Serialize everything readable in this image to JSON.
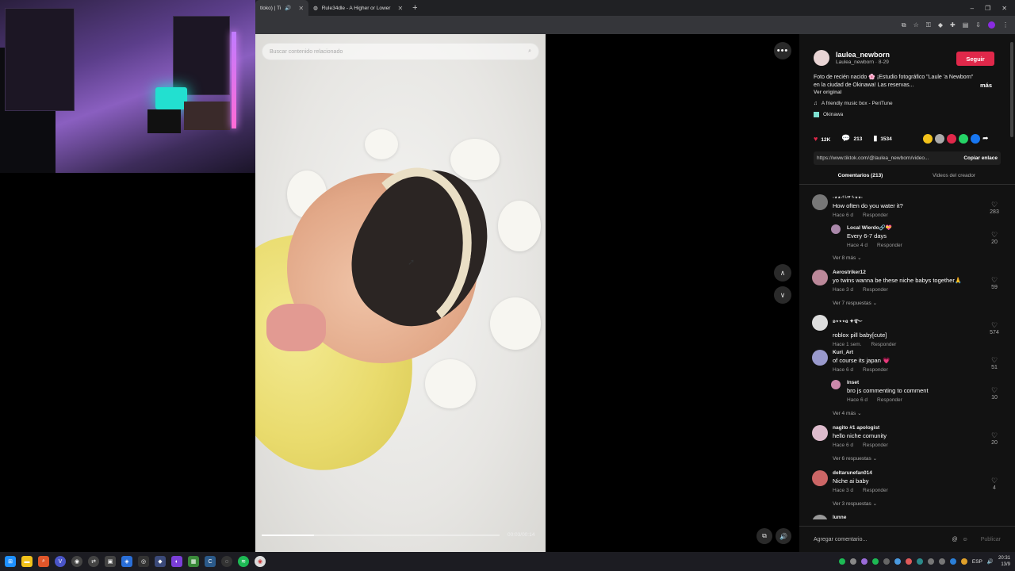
{
  "browser": {
    "tabs": [
      {
        "label": "tloko) | Ti",
        "active": true
      },
      {
        "label": "Rule34dle - A Higher or Lower",
        "active": false
      }
    ],
    "new_tab": "+",
    "window_controls": [
      "–",
      "❐",
      "✕"
    ]
  },
  "video": {
    "search_placeholder": "Buscar contenido relacionado",
    "time": "00:03/00:14",
    "progress": 0.22
  },
  "author": {
    "username": "laulea_newborn",
    "handle_date": "Laulea_newborn · 8-29",
    "follow_label": "Seguir"
  },
  "description": {
    "text": "Foto de recién nacido 🌸 ¡Estudio fotográfico \"Laule 'a Newborn\" en la ciudad de Okinawa! Las reservas...",
    "more": "más",
    "see_original": "Ver original",
    "music": "A friendly music box - PeriTune",
    "location": "Okinawa"
  },
  "stats": {
    "likes": "12K",
    "comments": "213",
    "saves": "1534"
  },
  "link": {
    "url": "https://www.tiktok.com/@laulea_newborn/video...",
    "copy_label": "Copiar enlace"
  },
  "panel_tabs": {
    "comments": "Comentarios (213)",
    "creator_videos": "Videos del creador"
  },
  "comments": [
    {
      "user": "·⋆⋆·ᵗ ᴸᵒʳ ᵗ·⋆⋆·",
      "text": "How often do you water it?",
      "time": "Hace 6 d",
      "reply": "Responder",
      "likes": "283",
      "color": "#777"
    },
    {
      "user": "Local Wierdo🔗💝",
      "text": "Every 6-7 days",
      "time": "Hace 4 d",
      "reply": "Responder",
      "likes": "20",
      "color": "#a8a"
    },
    {
      "user": "Aerostriker12",
      "text": "yo twins wanna be these niche babys together🙏",
      "time": "Hace 3 d",
      "reply": "Responder",
      "likes": "59",
      "color": "#b89"
    },
    {
      "user": "ʚ⋆⋆⋆ɞ ✦࿐",
      "text": "roblox pill baby[cute]",
      "time": "Hace 1 sem.",
      "reply": "Responder",
      "likes": "574",
      "color": "#ddd"
    },
    {
      "user": "Kuri_Art",
      "text": "of course its japan 💗",
      "time": "Hace 6 d",
      "reply": "Responder",
      "likes": "51",
      "color": "#99c"
    },
    {
      "user": "Inset",
      "text": "bro js commenting to comment",
      "time": "Hace 6 d",
      "reply": "Responder",
      "likes": "10",
      "color": "#c8a"
    },
    {
      "user": "nagito #1 apologist",
      "text": "hello niche comunity",
      "time": "Hace 6 d",
      "reply": "Responder",
      "likes": "20",
      "color": "#dbc"
    },
    {
      "user": "deltarunefan014",
      "text": "Niche ai baby",
      "time": "Hace 3 d",
      "reply": "Responder",
      "likes": "4",
      "color": "#c66"
    },
    {
      "user": "lunne",
      "text": "",
      "time": "",
      "reply": "",
      "likes": "",
      "color": "#999"
    }
  ],
  "view_more": [
    "Ver 8 más",
    "Ver 7 respuestas",
    "Ver 4 más",
    "Ver 6 respuestas",
    "Ver 3 respuestas"
  ],
  "add_comment": {
    "placeholder": "Agregar comentario...",
    "publish": "Publicar"
  },
  "taskbar": {
    "lang": "ESP",
    "time": "20:31",
    "date": "13/9"
  }
}
